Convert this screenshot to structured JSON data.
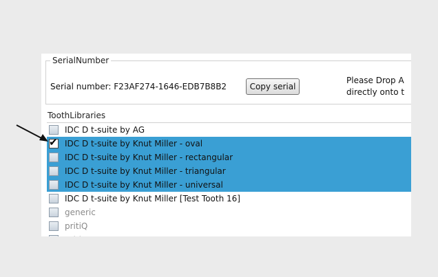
{
  "serial_group": {
    "title": "SerialNumber",
    "serial_label": "Serial number: F23AF274-1646-EDB7B8B2",
    "copy_button": "Copy serial",
    "drop_hint_line1": "Please Drop A",
    "drop_hint_line2": "directly onto t"
  },
  "tooth_libraries": {
    "title": "ToothLibraries",
    "items": [
      {
        "label": "IDC D t-suite by AG",
        "checked": false,
        "selected": false
      },
      {
        "label": "IDC D t-suite by Knut Miller - oval",
        "checked": true,
        "selected": true
      },
      {
        "label": "IDC D t-suite by Knut Miller - rectangular",
        "checked": false,
        "selected": true
      },
      {
        "label": "IDC D t-suite by Knut Miller - triangular",
        "checked": false,
        "selected": true
      },
      {
        "label": "IDC D t-suite by Knut Miller - universal",
        "checked": false,
        "selected": true
      },
      {
        "label": "IDC D t-suite by Knut Miller [Test Tooth 16]",
        "checked": false,
        "selected": false
      },
      {
        "label": "generic",
        "checked": false,
        "selected": false
      },
      {
        "label": "pritiQ",
        "checked": false,
        "selected": false
      },
      {
        "label": "pritiD",
        "checked": false,
        "selected": false
      }
    ]
  },
  "colors": {
    "selection": "#3a9fd4",
    "background": "#ebebeb"
  }
}
